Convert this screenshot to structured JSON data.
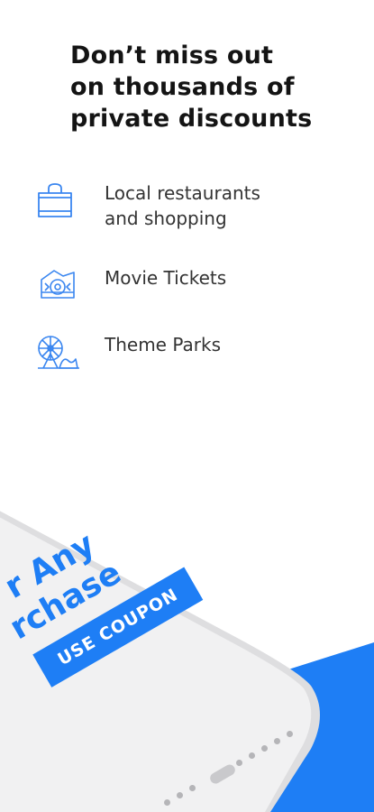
{
  "headline": {
    "line1": "Don’t miss out",
    "line2": "on thousands of",
    "line3": "private discounts"
  },
  "features": [
    {
      "icon": "shopping-bag-icon",
      "line1": "Local restaurants",
      "line2": "and shopping"
    },
    {
      "icon": "movie-ticket-icon",
      "line1": "Movie Tickets",
      "line2": ""
    },
    {
      "icon": "ferris-wheel-icon",
      "line1": "Theme Parks",
      "line2": ""
    }
  ],
  "phone_mockup": {
    "promo_line1": "r Any",
    "promo_line2": "rchase",
    "coupon_button": "USE COUPON"
  },
  "colors": {
    "accent": "#1e7ef5",
    "icon_stroke": "#3a86f0",
    "text": "#141414"
  }
}
